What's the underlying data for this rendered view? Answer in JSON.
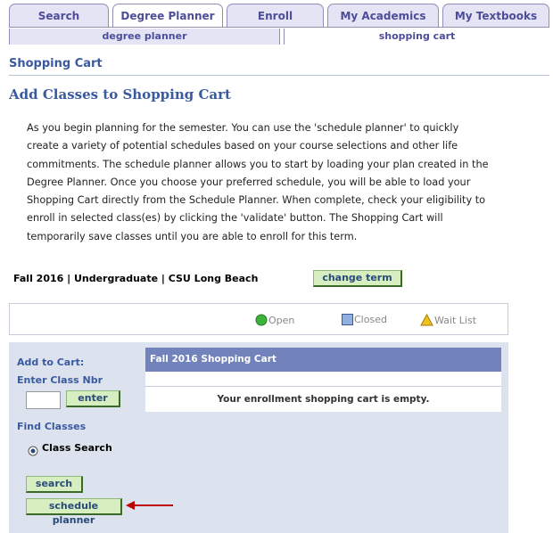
{
  "tabs": [
    {
      "label": "Search",
      "active": false
    },
    {
      "label": "Degree Planner",
      "active": true
    },
    {
      "label": "Enroll",
      "active": false
    },
    {
      "label": "My Academics",
      "active": false
    },
    {
      "label": "My Textbooks",
      "active": false
    }
  ],
  "subnav": [
    {
      "label": "degree planner",
      "active": false
    },
    {
      "label": "shopping cart",
      "active": true
    }
  ],
  "page": {
    "section_title": "Shopping Cart",
    "title": "Add Classes to Shopping Cart",
    "intro_lines": [
      "As you begin planning for the semester.  You can use the 'schedule planner' to quickly",
      "create a variety of potential schedules based on your course selections and other life",
      "commitments. The schedule planner allows you to start by loading your plan created in the",
      "Degree Planner. Once you choose your preferred schedule, you will be able to load your",
      "Shopping Cart directly from the Schedule Planner. When complete, check your eligibility to",
      "enroll in selected class(es) by clicking the 'validate' button. The Shopping Cart will",
      "temporarily save classes until you are able to enroll for this term."
    ]
  },
  "term": {
    "label": "Fall 2016 | Undergraduate | CSU Long Beach",
    "change_button": "change term"
  },
  "legend": {
    "open": "Open",
    "closed": "Closed",
    "waitlist": "Wait List",
    "colors": {
      "open": "#3cb43c",
      "closed": "#8fb0e0",
      "waitlist": "#f0c020"
    }
  },
  "add_panel": {
    "add_to_cart": "Add to Cart:",
    "enter_class_nbr": "Enter Class Nbr",
    "class_nbr_value": "",
    "enter_button": "enter",
    "find_classes": "Find Classes",
    "class_search_option": "Class Search",
    "search_button": "search",
    "schedule_planner_button": "schedule planner"
  },
  "cart": {
    "header": "Fall 2016 Shopping Cart",
    "empty_message": "Your enrollment shopping cart is empty."
  },
  "colors": {
    "header_text": "#3a5aa0",
    "cart_header_bg": "#7283bb",
    "panel_bg": "#dde3ee",
    "button_bg": "#d6eec0",
    "arrow": "#c00000"
  }
}
